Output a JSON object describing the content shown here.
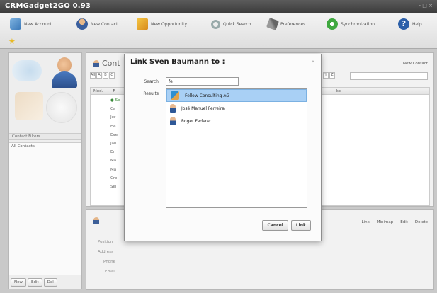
{
  "window": {
    "title": "CRMGadget2GO 0.93",
    "controls": "- □ ×"
  },
  "toolbar": {
    "items": [
      {
        "label": "New Account",
        "icon": "account-icon"
      },
      {
        "label": "New Contact",
        "icon": "contact-icon"
      },
      {
        "label": "New Opportunity",
        "icon": "opportunity-icon"
      },
      {
        "label": "Quick Search",
        "icon": "search-icon"
      },
      {
        "label": "Preferences",
        "icon": "preferences-icon"
      },
      {
        "label": "Synchronization",
        "icon": "sync-icon"
      },
      {
        "label": "Help",
        "icon": "help-icon"
      }
    ],
    "star": "★"
  },
  "left_panel": {
    "filters_header": "Contact Filters",
    "items": [
      "All Contacts"
    ],
    "buttons": {
      "new": "New",
      "edit": "Edit",
      "delete": "Del"
    }
  },
  "main_panel": {
    "title": "Cont",
    "new_contact": "New Contact",
    "alpha": [
      "All",
      "A",
      "B",
      "C"
    ],
    "alpha_right": [
      "Y",
      "Z"
    ],
    "columns": [
      "Mod.",
      "F"
    ],
    "rows": [
      "Se",
      "Ca",
      "Jer",
      "He",
      "Eve",
      "Jan",
      "Eri",
      "Ma",
      "Ma",
      "Cre",
      "Sei"
    ],
    "rows_right_header": "ko"
  },
  "detail_panel": {
    "actions": [
      "Link",
      "Minimap",
      "Edit",
      "Delete"
    ],
    "fields": [
      "Position",
      "Address",
      "Phone",
      "Email"
    ]
  },
  "dialog": {
    "title": "Link Sven Baumann to :",
    "close": "×",
    "search_label": "Search",
    "search_value": "fe",
    "results_label": "Results",
    "results": [
      {
        "name": "Fellow Consulting AG",
        "type": "company-icon",
        "selected": true
      },
      {
        "name": "José Manuel Ferreira",
        "type": "person-icon",
        "selected": false
      },
      {
        "name": "Roger Federer",
        "type": "person-icon",
        "selected": false
      }
    ],
    "cancel_label": "Cancel",
    "link_label": "Link"
  }
}
